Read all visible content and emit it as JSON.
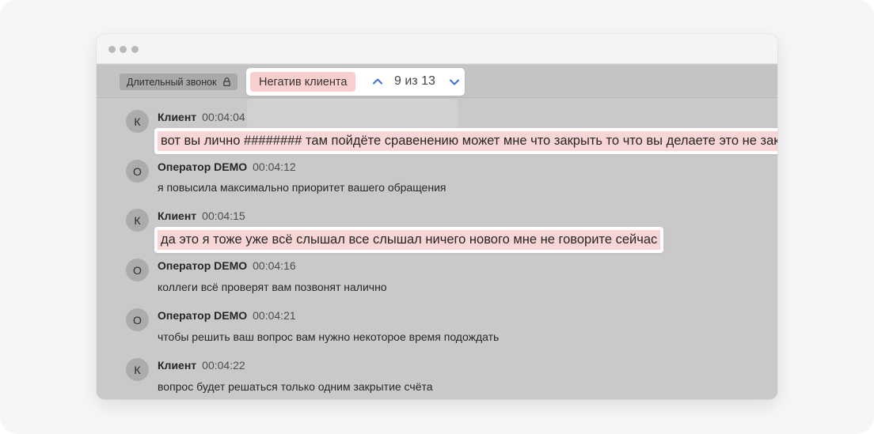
{
  "toolbar": {
    "long_call_tag": "Длительный звонок",
    "lock_icon": "lock-icon",
    "search_tag": "Негатив клиента",
    "counter": "9 из 13",
    "up_icon": "chevron-up-icon",
    "down_icon": "chevron-down-icon",
    "accent_color": "#3f6ed8",
    "highlight_color": "#f8d6d6"
  },
  "messages": [
    {
      "initial": "К",
      "author": "Клиент",
      "time": "00:04:04",
      "text": "вот вы лично ######## там пойдёте сравенению может мне что закрыть то что вы делаете это не законно",
      "highlighted": true
    },
    {
      "initial": "О",
      "author": "Оператор DEMO",
      "time": "00:04:12",
      "text": "я повысила максимально приоритет вашего обращения",
      "highlighted": false
    },
    {
      "initial": "К",
      "author": "Клиент",
      "time": "00:04:15",
      "text": "да это я тоже уже всё слышал все слышал ничего нового мне не говорите сейчас",
      "highlighted": true
    },
    {
      "initial": "О",
      "author": "Оператор DEMO",
      "time": "00:04:16",
      "text": "коллеги всё проверят вам позвонят налично",
      "highlighted": false
    },
    {
      "initial": "О",
      "author": "Оператор DEMO",
      "time": "00:04:21",
      "text": "чтобы решить ваш вопрос вам нужно некоторое время подождать",
      "highlighted": false
    },
    {
      "initial": "К",
      "author": "Клиент",
      "time": "00:04:22",
      "text": "вопрос будет решаться только одним закрытие счёта",
      "highlighted": false
    }
  ]
}
